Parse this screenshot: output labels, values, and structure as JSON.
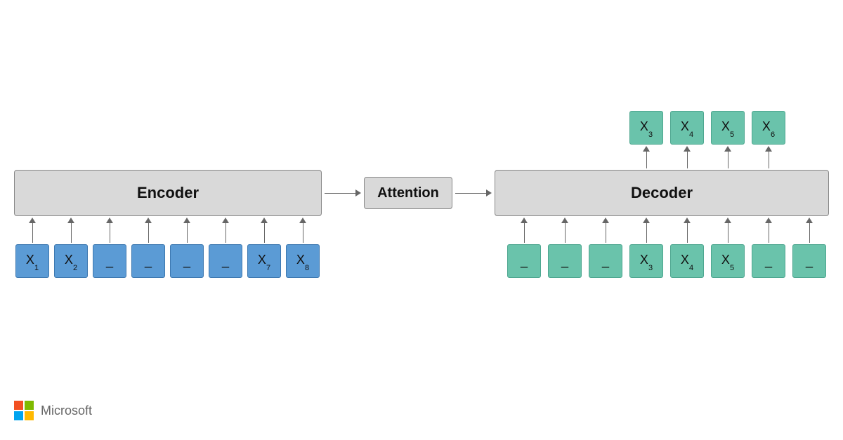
{
  "blocks": {
    "encoder_label": "Encoder",
    "attention_label": "Attention",
    "decoder_label": "Decoder"
  },
  "encoder_inputs": [
    {
      "text": "X",
      "sub": "1"
    },
    {
      "text": "X",
      "sub": "2"
    },
    {
      "text": "_",
      "sub": ""
    },
    {
      "text": "_",
      "sub": ""
    },
    {
      "text": "_",
      "sub": ""
    },
    {
      "text": "_",
      "sub": ""
    },
    {
      "text": "X",
      "sub": "7"
    },
    {
      "text": "X",
      "sub": "8"
    }
  ],
  "decoder_inputs": [
    {
      "text": "_",
      "sub": ""
    },
    {
      "text": "_",
      "sub": ""
    },
    {
      "text": "_",
      "sub": ""
    },
    {
      "text": "X",
      "sub": "3"
    },
    {
      "text": "X",
      "sub": "4"
    },
    {
      "text": "X",
      "sub": "5"
    },
    {
      "text": "_",
      "sub": ""
    },
    {
      "text": "_",
      "sub": ""
    }
  ],
  "decoder_outputs": [
    {
      "text": "X",
      "sub": "3"
    },
    {
      "text": "X",
      "sub": "4"
    },
    {
      "text": "X",
      "sub": "5"
    },
    {
      "text": "X",
      "sub": "6"
    }
  ],
  "logo_text": "Microsoft",
  "colors": {
    "encoder_token": "#5b9bd5",
    "decoder_token": "#6ac3ab",
    "block_bg": "#d9d9d9"
  }
}
